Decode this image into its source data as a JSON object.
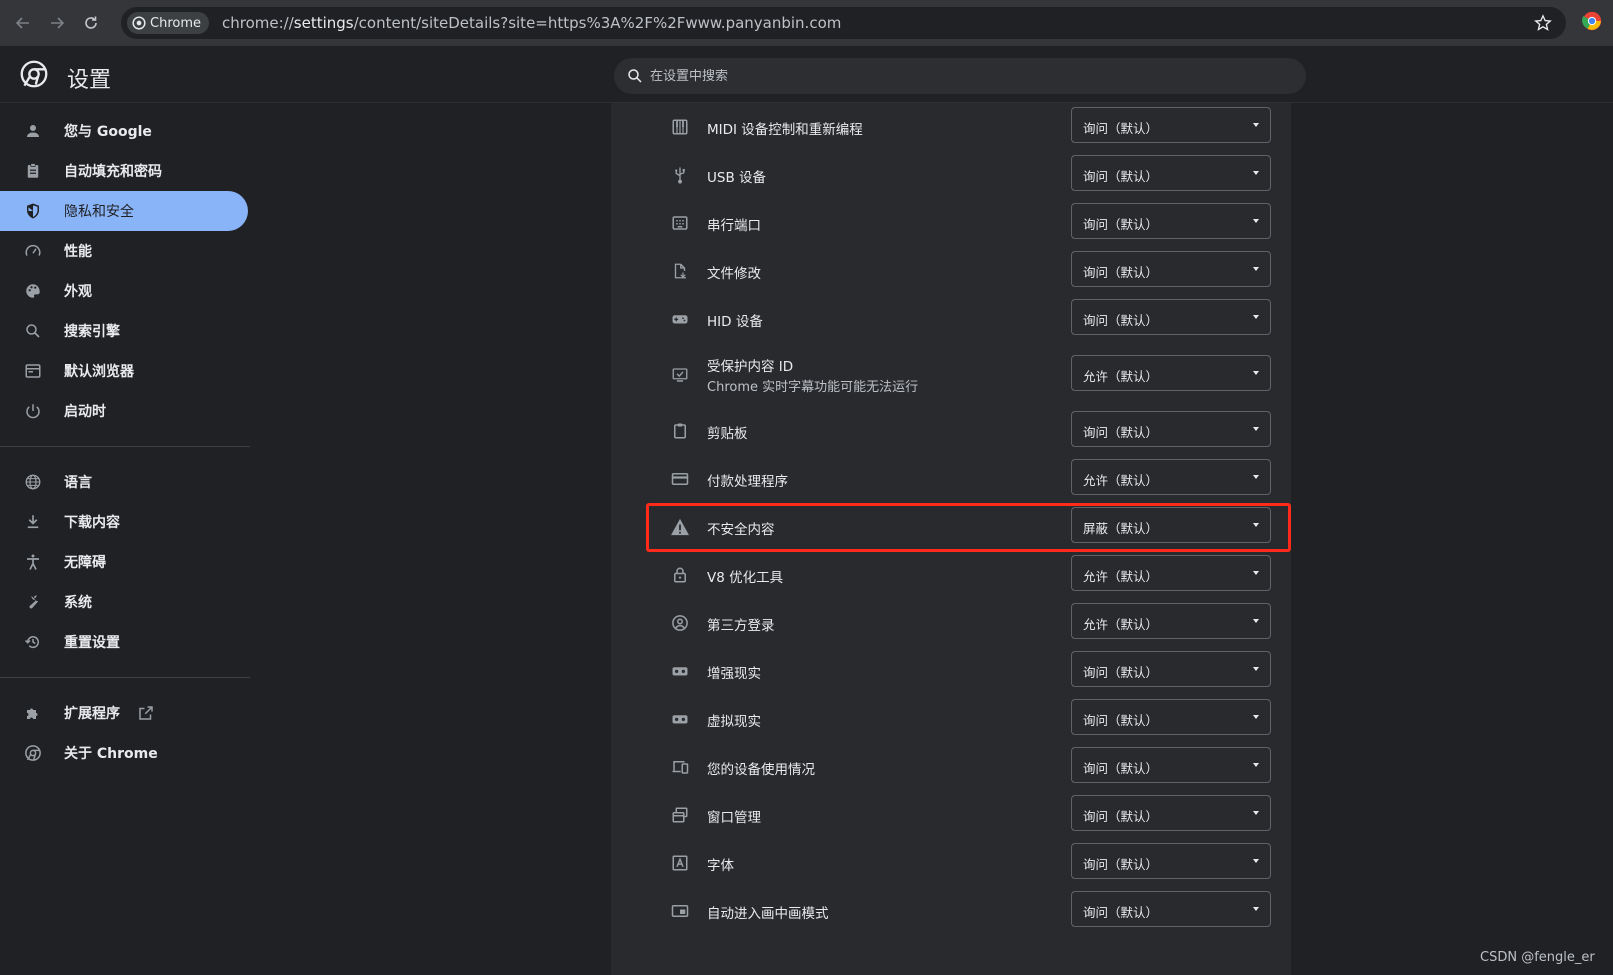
{
  "browser": {
    "chip_label": "Chrome",
    "url_scheme": "chrome://",
    "url_host": "settings",
    "url_path": "/content/siteDetails?site=https%3A%2F%2Fwww.panyanbin.com"
  },
  "header": {
    "title": "设置",
    "search_placeholder": "在设置中搜索"
  },
  "sidebar": {
    "items": [
      {
        "label": "您与 Google",
        "icon": "person-icon"
      },
      {
        "label": "自动填充和密码",
        "icon": "clipboard-icon"
      },
      {
        "label": "隐私和安全",
        "icon": "shield-icon",
        "active": true
      },
      {
        "label": "性能",
        "icon": "speedometer-icon"
      },
      {
        "label": "外观",
        "icon": "palette-icon"
      },
      {
        "label": "搜索引擎",
        "icon": "search-icon"
      },
      {
        "label": "默认浏览器",
        "icon": "browser-icon"
      },
      {
        "label": "启动时",
        "icon": "power-icon"
      }
    ],
    "items2": [
      {
        "label": "语言",
        "icon": "globe-icon"
      },
      {
        "label": "下载内容",
        "icon": "download-icon"
      },
      {
        "label": "无障碍",
        "icon": "accessibility-icon"
      },
      {
        "label": "系统",
        "icon": "wrench-icon"
      },
      {
        "label": "重置设置",
        "icon": "history-icon"
      }
    ],
    "items3": [
      {
        "label": "扩展程序",
        "icon": "puzzle-icon"
      },
      {
        "label": "关于 Chrome",
        "icon": "chrome-icon"
      }
    ]
  },
  "permissions": [
    {
      "label": "MIDI 设备控制和重新编程",
      "value": "询问（默认）",
      "icon": "piano-icon"
    },
    {
      "label": "USB 设备",
      "value": "询问（默认）",
      "icon": "usb-icon"
    },
    {
      "label": "串行端口",
      "value": "询问（默认）",
      "icon": "serial-port-icon"
    },
    {
      "label": "文件修改",
      "value": "询问（默认）",
      "icon": "file-edit-icon"
    },
    {
      "label": "HID 设备",
      "value": "询问（默认）",
      "icon": "gamepad-icon"
    },
    {
      "label": "受保护内容 ID",
      "sub": "Chrome 实时字幕功能可能无法运行",
      "value": "允许（默认）",
      "icon": "protected-content-icon"
    },
    {
      "label": "剪贴板",
      "value": "询问（默认）",
      "icon": "clipboard-icon"
    },
    {
      "label": "付款处理程序",
      "value": "允许（默认）",
      "icon": "credit-card-icon"
    },
    {
      "label": "不安全内容",
      "value": "屏蔽（默认）",
      "icon": "warning-icon"
    },
    {
      "label": "V8 优化工具",
      "value": "允许（默认）",
      "icon": "lock-icon"
    },
    {
      "label": "第三方登录",
      "value": "允许（默认）",
      "icon": "account-circle-icon"
    },
    {
      "label": "增强现实",
      "value": "询问（默认）",
      "icon": "vr-headset-icon"
    },
    {
      "label": "虚拟现实",
      "value": "询问（默认）",
      "icon": "vr-headset-icon"
    },
    {
      "label": "您的设备使用情况",
      "value": "询问（默认）",
      "icon": "devices-icon"
    },
    {
      "label": "窗口管理",
      "value": "询问（默认）",
      "icon": "window-management-icon"
    },
    {
      "label": "字体",
      "value": "询问（默认）",
      "icon": "font-icon"
    },
    {
      "label": "自动进入画中画模式",
      "value": "询问（默认）",
      "icon": "picture-in-picture-icon"
    }
  ],
  "highlight_color": "#ff2a1a",
  "accent_color": "#8ab4f8",
  "watermark": "CSDN @fengle_er"
}
